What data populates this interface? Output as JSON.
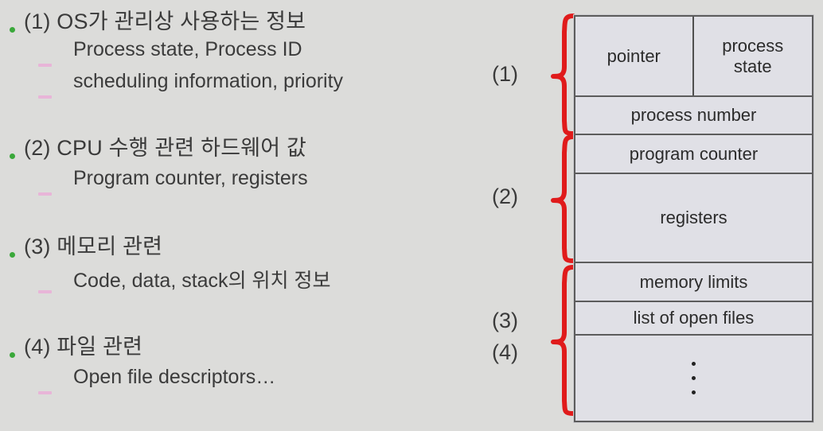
{
  "slide": {
    "background_color": "#dcdcda",
    "cut_off_top_line": "¸¸¸¸¸¸¸"
  },
  "bullets": [
    {
      "marker": "green-dot",
      "text": "(1) OS가 관리상 사용하는 정보",
      "sub": [
        {
          "marker": "pink-dash",
          "text": "Process state, Process ID"
        },
        {
          "marker": "pink-dash",
          "text": "scheduling information, priority"
        }
      ]
    },
    {
      "marker": "green-dot",
      "text": "(2) CPU 수행 관련 하드웨어 값",
      "sub": [
        {
          "marker": "pink-dash",
          "text": "Program counter, registers"
        }
      ]
    },
    {
      "marker": "green-dot",
      "text": "(3) 메모리 관련",
      "sub": [
        {
          "marker": "pink-dash",
          "text": "Code, data, stack의 위치 정보"
        }
      ]
    },
    {
      "marker": "green-dot",
      "text": "(4) 파일 관련",
      "sub": [
        {
          "marker": "pink-dash",
          "text": "Open file descriptors…"
        }
      ]
    }
  ],
  "diagram": {
    "name": "process-control-block",
    "brace_color": "#e01b1b",
    "border_color": "#5c5c5c",
    "cell_fill": "#e0e0e6",
    "group_labels": [
      {
        "id": "g1",
        "label": "(1)"
      },
      {
        "id": "g2",
        "label": "(2)"
      },
      {
        "id": "g3",
        "label": "(3)"
      },
      {
        "id": "g4",
        "label": "(4)"
      }
    ],
    "rows": [
      {
        "id": "r1",
        "type": "split",
        "left": "pointer",
        "right": "process\nstate"
      },
      {
        "id": "r2",
        "type": "single",
        "label": "process number"
      },
      {
        "id": "r3",
        "type": "single",
        "label": "program counter"
      },
      {
        "id": "r4",
        "type": "single",
        "label": "registers"
      },
      {
        "id": "r5",
        "type": "single",
        "label": "memory limits"
      },
      {
        "id": "r6",
        "type": "single",
        "label": "list of open files"
      },
      {
        "id": "r7",
        "type": "dots",
        "label": ""
      }
    ],
    "row_cells": {
      "pointer": "pointer",
      "process_state_line1": "process",
      "process_state_line2": "state",
      "process_number": "process number",
      "program_counter": "program counter",
      "registers": "registers",
      "memory_limits": "memory limits",
      "list_of_open_files": "list of open files"
    }
  }
}
